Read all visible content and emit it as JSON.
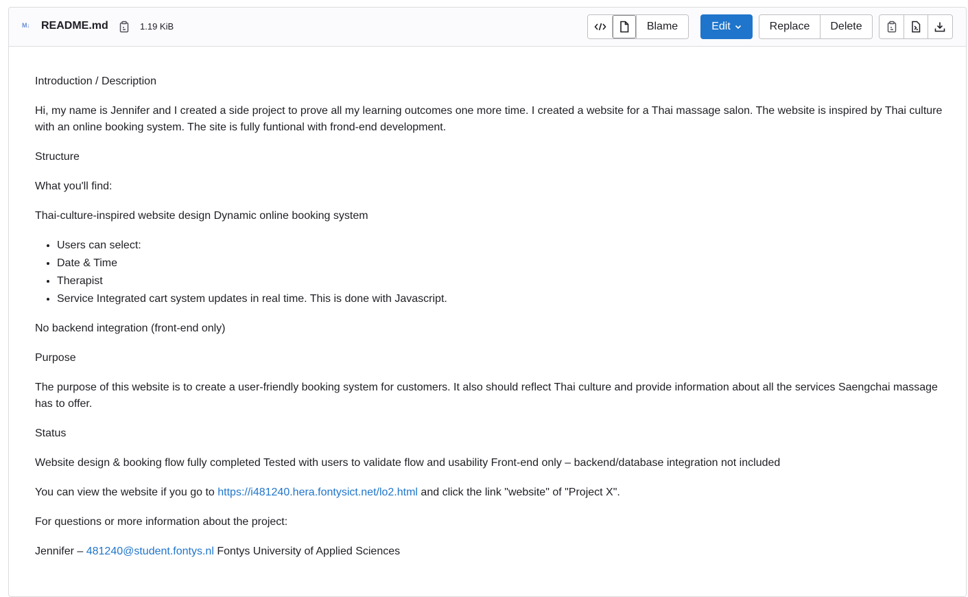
{
  "file": {
    "type_icon": "M↓",
    "name": "README.md",
    "size": "1.19 KiB"
  },
  "toolbar": {
    "blame_label": "Blame",
    "edit_label": "Edit",
    "replace_label": "Replace",
    "delete_label": "Delete"
  },
  "icons": {
    "code": "code-icon",
    "document": "document-icon",
    "copy_path": "copy-to-clipboard-icon",
    "copy_contents": "copy-contents-icon",
    "raw": "open-raw-icon",
    "download": "download-icon",
    "chevron": "chevron-down-icon"
  },
  "colors": {
    "primary": "#1f75cb",
    "link": "#1f75cb",
    "header_bg": "#fbfafd",
    "border": "#dcdcde"
  },
  "readme": {
    "intro_heading": "Introduction / Description",
    "intro_text": "Hi, my name is Jennifer and I created a side project to prove all my learning outcomes one more time. I created a website for a Thai massage salon. The website is inspired by Thai culture with an online booking system. The site is fully funtional with frond-end development.",
    "structure_heading": "Structure",
    "find_label": "What you'll find:",
    "features": "Thai-culture-inspired website design Dynamic online booking system",
    "list": [
      "Users can select:",
      "Date & Time",
      "Therapist",
      "Service Integrated cart system updates in real time. This is done with Javascript."
    ],
    "no_backend": "No backend integration (front-end only)",
    "purpose_heading": "Purpose",
    "purpose_text": "The purpose of this website is to create a user-friendly booking system for customers. It also should reflect Thai culture and provide information about all the services Saengchai massage has to offer.",
    "status_heading": "Status",
    "status_text": "Website design & booking flow fully completed Tested with users to validate flow and usability Front-end only – backend/database integration not included",
    "view_prefix": "You can view the website if you go to ",
    "view_link": "https://i481240.hera.fontysict.net/lo2.html",
    "view_suffix": " and click the link \"website\" of \"Project X\".",
    "questions": "For questions or more information about the project:",
    "contact_prefix": "Jennifer – ",
    "contact_email": "481240@student.fontys.nl",
    "contact_suffix": " Fontys University of Applied Sciences"
  }
}
